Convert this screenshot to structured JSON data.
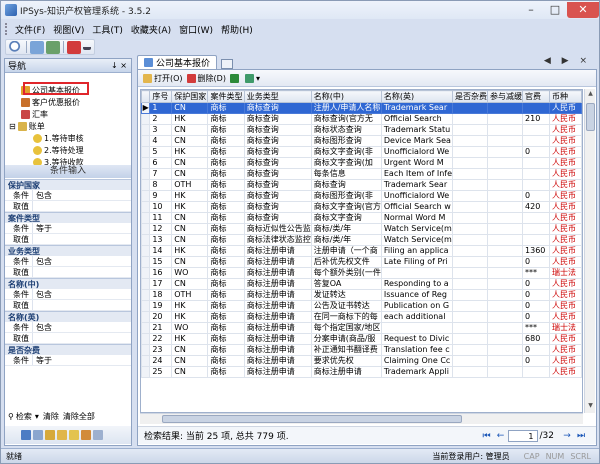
{
  "window": {
    "title": "IPSys-知识产权管理系统 - 3.5.2",
    "controls": [
      "–",
      "□",
      "✕"
    ]
  },
  "menu": [
    "文件(F)",
    "视图(V)",
    "工具(T)",
    "收藏夹(A)",
    "窗口(W)",
    "帮助(H)"
  ],
  "nav": {
    "title": "导航",
    "pin": "↓ ×",
    "tree": [
      "公司基本报价",
      "客户优惠报价",
      "汇率",
      "账单",
      "1.等待审核",
      "2.等待处理",
      "3.等待收款"
    ],
    "conditions_title": "条件输入",
    "groups": [
      {
        "title": "保护国家",
        "rows": [
          [
            "条件",
            "包含"
          ],
          [
            "取值",
            ""
          ]
        ]
      },
      {
        "title": "案件类型",
        "rows": [
          [
            "条件",
            "等于"
          ],
          [
            "取值",
            ""
          ]
        ]
      },
      {
        "title": "业务类型",
        "rows": [
          [
            "条件",
            "包含"
          ],
          [
            "取值",
            ""
          ]
        ]
      },
      {
        "title": "名称(中)",
        "rows": [
          [
            "条件",
            "包含"
          ],
          [
            "取值",
            ""
          ]
        ]
      },
      {
        "title": "名称(英)",
        "rows": [
          [
            "条件",
            "包含"
          ],
          [
            "取值",
            ""
          ]
        ]
      },
      {
        "title": "是否杂费",
        "rows": [
          [
            "条件",
            "等于"
          ]
        ]
      }
    ],
    "actions": {
      "search": "检索",
      "clear": "清除",
      "clear_all": "清除全部"
    }
  },
  "tabs": {
    "active": "公司基本报价"
  },
  "content_toolbar": {
    "open": "打开(O)",
    "delete": "删除(D)"
  },
  "grid": {
    "headers": [
      "序号",
      "保护国家",
      "案件类型",
      "业务类型",
      "名称(中)",
      "名称(英)",
      "是否杂费",
      "参与减缓",
      "官费",
      "币种"
    ],
    "rows": [
      [
        "1",
        "CN",
        "商标",
        "商标查询",
        "注册人/申请人名称",
        "Trademark Sear",
        "",
        "",
        "",
        "人民币"
      ],
      [
        "2",
        "HK",
        "商标",
        "商标查询",
        "商标查询(官方无",
        "Official Search",
        "",
        "",
        "210",
        "人民币"
      ],
      [
        "3",
        "CN",
        "商标",
        "商标查询",
        "商标状态查询",
        "Trademark Statu",
        "",
        "",
        "",
        "人民币"
      ],
      [
        "4",
        "CN",
        "商标",
        "商标查询",
        "商标图形查询",
        "Device Mark Sea",
        "",
        "",
        "",
        "人民币"
      ],
      [
        "5",
        "HK",
        "商标",
        "商标查询",
        "商标文字查询(非",
        "Unofficialord We",
        "",
        "",
        "0",
        "人民币"
      ],
      [
        "6",
        "CN",
        "商标",
        "商标查询",
        "商标文字查询(加",
        "Urgent Word M",
        "",
        "",
        "",
        "人民币"
      ],
      [
        "7",
        "CN",
        "商标",
        "商标查询",
        "每条信息",
        "Each Item of Infe",
        "",
        "",
        "",
        "人民币"
      ],
      [
        "8",
        "OTH",
        "商标",
        "商标查询",
        "商标查询",
        "Trademark Sear",
        "",
        "",
        "",
        "人民币"
      ],
      [
        "9",
        "HK",
        "商标",
        "商标查询",
        "商标图形查询(非",
        "Unofficialord We",
        "",
        "",
        "0",
        "人民币"
      ],
      [
        "10",
        "HK",
        "商标",
        "商标查询",
        "商标文字查询(官方",
        "Official Search w",
        "",
        "",
        "420",
        "人民币"
      ],
      [
        "11",
        "CN",
        "商标",
        "商标查询",
        "商标文字查询",
        "Normal Word M",
        "",
        "",
        "",
        "人民币"
      ],
      [
        "12",
        "CN",
        "商标",
        "商标近似性公告监",
        "商标/类/年",
        "Watch Service(m",
        "",
        "",
        "",
        "人民币"
      ],
      [
        "13",
        "CN",
        "商标",
        "商标法律状态监控",
        "商标/类/年",
        "Watch Service(m",
        "",
        "",
        "",
        "人民币"
      ],
      [
        "14",
        "HK",
        "商标",
        "商标注册申请",
        "注册申请（一个商",
        "Filing an applica",
        "",
        "",
        "1360",
        "人民币"
      ],
      [
        "15",
        "CN",
        "商标",
        "商标注册申请",
        "后补优先权文件",
        "Late Filing of Pri",
        "",
        "",
        "0",
        "人民币"
      ],
      [
        "16",
        "WO",
        "商标",
        "商标注册申请",
        "每个额外类别(一件",
        "",
        "",
        "",
        "***",
        "瑞士法"
      ],
      [
        "17",
        "CN",
        "商标",
        "商标注册申请",
        "答复OA",
        "Responding to a",
        "",
        "",
        "0",
        "人民币"
      ],
      [
        "18",
        "OTH",
        "商标",
        "商标注册申请",
        "发证转达",
        "Issuance of Reg",
        "",
        "",
        "0",
        "人民币"
      ],
      [
        "19",
        "HK",
        "商标",
        "商标注册申请",
        "公告及证书转达",
        "Publication on G",
        "",
        "",
        "0",
        "人民币"
      ],
      [
        "20",
        "HK",
        "商标",
        "商标注册申请",
        "在同一商标下的每",
        "each additional",
        "",
        "",
        "0",
        "人民币"
      ],
      [
        "21",
        "WO",
        "商标",
        "商标注册申请",
        "每个指定国家/地区",
        "",
        "",
        "",
        "***",
        "瑞士法"
      ],
      [
        "22",
        "HK",
        "商标",
        "商标注册申请",
        "分案申请(商品/服",
        "Request to Divic",
        "",
        "",
        "680",
        "人民币"
      ],
      [
        "23",
        "CN",
        "商标",
        "商标注册申请",
        "补正通知书翻译费",
        "Translation fee c",
        "",
        "",
        "0",
        "人民币"
      ],
      [
        "24",
        "CN",
        "商标",
        "商标注册申请",
        "要求优先权",
        "Claiming One Cc",
        "",
        "",
        "0",
        "人民币"
      ],
      [
        "25",
        "CN",
        "商标",
        "商标注册申请",
        "商标注册申请",
        "Trademark Appli",
        "",
        "",
        "",
        "人民币"
      ]
    ],
    "selected_row": 1
  },
  "status": {
    "result": "检索结果: 当前 25 项, 总共 779 项.",
    "page": "1",
    "total_pages": "/32"
  },
  "statusbar": {
    "left": "就绪",
    "user": "当前登录用户: 管理员",
    "caps": "CAP",
    "num": "NUM",
    "scrl": "SCRL"
  }
}
